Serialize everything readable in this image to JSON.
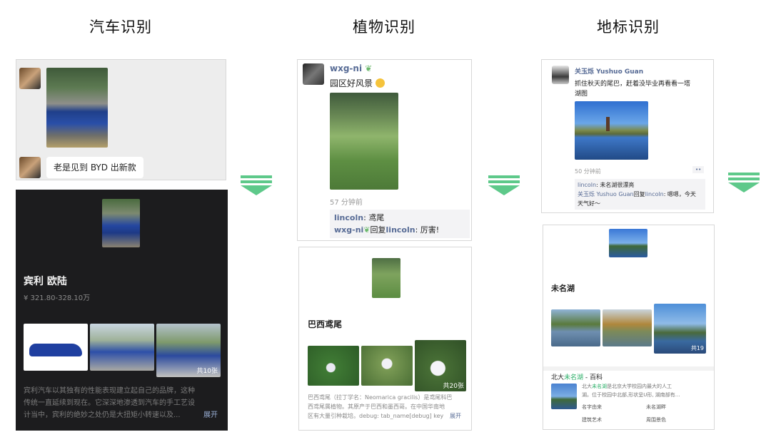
{
  "headings": {
    "car": "汽车识别",
    "plant": "植物识别",
    "landmark": "地标识别"
  },
  "car": {
    "chat_message": "老是见到 BYD 出新款",
    "result_name": "宾利 欧陆",
    "price": "¥ 321.80-328.10万",
    "gallery_count": "共10张",
    "description_line1": "宾利汽车以其独有的性能表现建立起自己的品牌，这种",
    "description_line2": "传统一直延续到现在。它深深地渗透到汽车的手工艺设",
    "description_line3": "计当中，宾利的绝妙之处仍是大扭矩小转速以及...",
    "expand_label": "展开"
  },
  "plant": {
    "username": "wxg-ni",
    "post_text": "园区好风景",
    "time": "57 分钟前",
    "comment1_user": "lincoln",
    "comment1_text": ": 鸢尾",
    "comment2_user": "wxg-ni",
    "comment2_reply": "回复",
    "comment2_target": "lincoln",
    "comment2_text": ": 厉害!",
    "result_name": "巴西鸢尾",
    "gallery_count": "共20张",
    "description_line1": "巴西鸢尾（拉丁学名：Neomarica gracilis）是鸢尾科巴",
    "description_line2": "西鸢尾属植物。其原产于巴西和墨西哥。在中国华南地",
    "description_line3": "区有大量引种栽培。debug: tab_name[debug] key ...",
    "expand_label": "展开"
  },
  "landmark": {
    "username": "关玉烁 Yushuo Guan",
    "post_line1": "抓住秋天的尾巴，赶着没毕业再看看一塔",
    "post_line2": "湖图",
    "time": "50 分钟前",
    "more_label": "••",
    "comment1_user": "lincoln",
    "comment1_text": ": 未名湖很漂亮",
    "comment2_user": "关玉烁 Yushuo Guan",
    "comment2_reply": "回复",
    "comment2_target": "lincoln",
    "comment2_text": ": 嗯嗯，今天",
    "comment2_cont": "天气好～",
    "result_name": "未名湖",
    "gallery_count": "共19",
    "baike_prefix": "北大",
    "baike_hl": "未名湖",
    "baike_suffix": " - 百科",
    "baike_line1_prefix": "北大",
    "baike_line1_hl": "未名湖",
    "baike_line1_rest": "是北京大学校园内最大的人工",
    "baike_line2": "湖。位于校园中北部,形状呈U形, 湖南部有...",
    "links": [
      "名字由来",
      "未名湖畔",
      "建筑艺术",
      "周围景色"
    ]
  },
  "colors": {
    "arrow": "#5ec98a",
    "link": "#576b95",
    "highlight": "#2aae67",
    "dark_panel": "#1c1c1e"
  }
}
